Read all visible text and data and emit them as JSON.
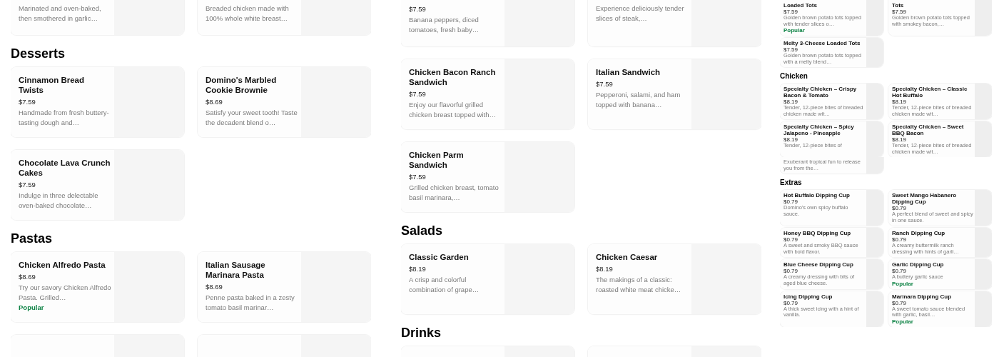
{
  "panels": [
    {
      "sections": [
        {
          "items": [
            {
              "kind": "cut_top",
              "description": "Marinated and oven-baked, then smothered in garlic…"
            },
            {
              "kind": "cut_top",
              "description": "Breaded chicken made with 100% whole white breast…"
            }
          ]
        },
        {
          "heading": "Desserts",
          "items": [
            {
              "kind": "item",
              "title": "Cinnamon Bread Twists",
              "price": "$7.59",
              "description": "Handmade from fresh buttery-tasting dough and…"
            },
            {
              "kind": "item",
              "title": "Domino's Marbled Cookie Brownie",
              "price": "$8.69",
              "description": "Satisfy your sweet tooth! Taste the decadent blend o…"
            },
            {
              "kind": "item",
              "title": "Chocolate Lava Crunch Cakes",
              "price": "$7.59",
              "description": "Indulge in three delectable oven-baked chocolate…"
            }
          ]
        },
        {
          "heading": "Pastas",
          "items": [
            {
              "kind": "item",
              "title": "Chicken Alfredo Pasta",
              "price": "$8.69",
              "description": "Try our savory Chicken Alfredo Pasta. Grilled…",
              "badge": "Popular"
            },
            {
              "kind": "item",
              "title": "Italian Sausage Marinara Pasta",
              "price": "$8.69",
              "description": "Penne pasta baked in a zesty tomato basil marinar…"
            },
            {
              "kind": "cut_bottom"
            },
            {
              "kind": "cut_bottom"
            }
          ]
        }
      ]
    },
    {
      "sections": [
        {
          "items": [
            {
              "kind": "cut_top",
              "price": "$7.59",
              "description": "Banana peppers, diced tomatoes, fresh baby…"
            },
            {
              "kind": "cut_top",
              "description": "Experience deliciously tender slices of steak,…"
            },
            {
              "kind": "item",
              "title": "Chicken Bacon Ranch Sandwich",
              "price": "$7.59",
              "description": "Enjoy our flavorful grilled chicken breast topped with…"
            },
            {
              "kind": "item",
              "title": "Italian Sandwich",
              "price": "$7.59",
              "description": "Pepperoni, salami, and ham topped with banana…"
            },
            {
              "kind": "item",
              "title": "Chicken Parm Sandwich",
              "price": "$7.59",
              "description": "Grilled chicken breast, tomato basil marinara,…"
            }
          ]
        },
        {
          "heading": "Salads",
          "items": [
            {
              "kind": "item",
              "title": "Classic Garden",
              "price": "$8.19",
              "description": "A crisp and colorful combination of grape…"
            },
            {
              "kind": "item",
              "title": "Chicken Caesar",
              "price": "$8.19",
              "description": "The makings of a classic: roasted white meat chicke…"
            }
          ]
        },
        {
          "heading": "Drinks",
          "items": [
            {
              "kind": "cut_bottom"
            },
            {
              "kind": "cut_bottom"
            }
          ]
        }
      ]
    },
    {
      "sections": [
        {
          "items": [
            {
              "kind": "cut_top",
              "title": "Loaded Tots",
              "price": "$7.59",
              "description": "Golden brown potato tots topped with tender slices o…",
              "badge": "Popular"
            },
            {
              "kind": "cut_top",
              "title": "Tots",
              "price": "$7.59",
              "description": "Golden brown potato tots topped with smokey bacon,…"
            },
            {
              "kind": "item",
              "title": "Melty 3-Cheese Loaded Tots",
              "price": "$7.59",
              "description": "Golden brown potato tots topped with a melty blend…"
            }
          ]
        },
        {
          "heading": "Chicken",
          "items": [
            {
              "kind": "item",
              "title": "Specialty Chicken – Crispy Bacon & Tomato",
              "price": "$8.19",
              "description": "Tender, 12-piece bites of breaded chicken made wit…"
            },
            {
              "kind": "item",
              "title": "Specialty Chicken – Classic Hot Buffalo",
              "price": "$8.19",
              "description": "Tender, 12-piece bites of breaded chicken made wit…"
            },
            {
              "kind": "item",
              "title": "Specialty Chicken – Spicy Jalapeno - Pineapple",
              "price": "$8.19",
              "description": "Tender, 12-piece bites of"
            },
            {
              "kind": "item",
              "title": "Specialty Chicken – Sweet BBQ Bacon",
              "price": "$8.19",
              "description": "Tender, 12-piece bites of breaded chicken made wit…"
            }
          ]
        }
      ]
    },
    {
      "sections": [
        {
          "items": [
            {
              "kind": "cut_top",
              "description": "Exuberant tropical fun to release you from the…"
            }
          ]
        },
        {
          "heading": "Extras",
          "items": [
            {
              "kind": "item",
              "title": "Hot Buffalo Dipping Cup",
              "price": "$0.79",
              "description": "Domino's own spicy buffalo sauce."
            },
            {
              "kind": "item",
              "title": "Sweet Mango Habanero Dipping Cup",
              "price": "$0.79",
              "description": "A perfect blend of sweet and spicy in one sauce."
            },
            {
              "kind": "item",
              "title": "Honey BBQ Dipping Cup",
              "price": "$0.79",
              "description": "A sweet and smoky BBQ sauce with bold flavor."
            },
            {
              "kind": "item",
              "title": "Ranch Dipping Cup",
              "price": "$0.79",
              "description": "A creamy buttermilk ranch dressing with hints of garli…"
            },
            {
              "kind": "item",
              "title": "Blue Cheese Dipping Cup",
              "price": "$0.79",
              "description": "A creamy dressing with bits of aged blue cheese."
            },
            {
              "kind": "item",
              "title": "Garlic Dipping Cup",
              "price": "$0.79",
              "description": "A buttery garlic sauce",
              "badge": "Popular"
            },
            {
              "kind": "item",
              "title": "Icing Dipping Cup",
              "price": "$0.79",
              "description": "A thick sweet icing with a hint of vanilla."
            },
            {
              "kind": "item",
              "title": "Marinara Dipping Cup",
              "price": "$0.79",
              "description": "A sweet tomato sauce blended with garlic, basil…",
              "badge": "Popular"
            }
          ]
        }
      ]
    }
  ]
}
